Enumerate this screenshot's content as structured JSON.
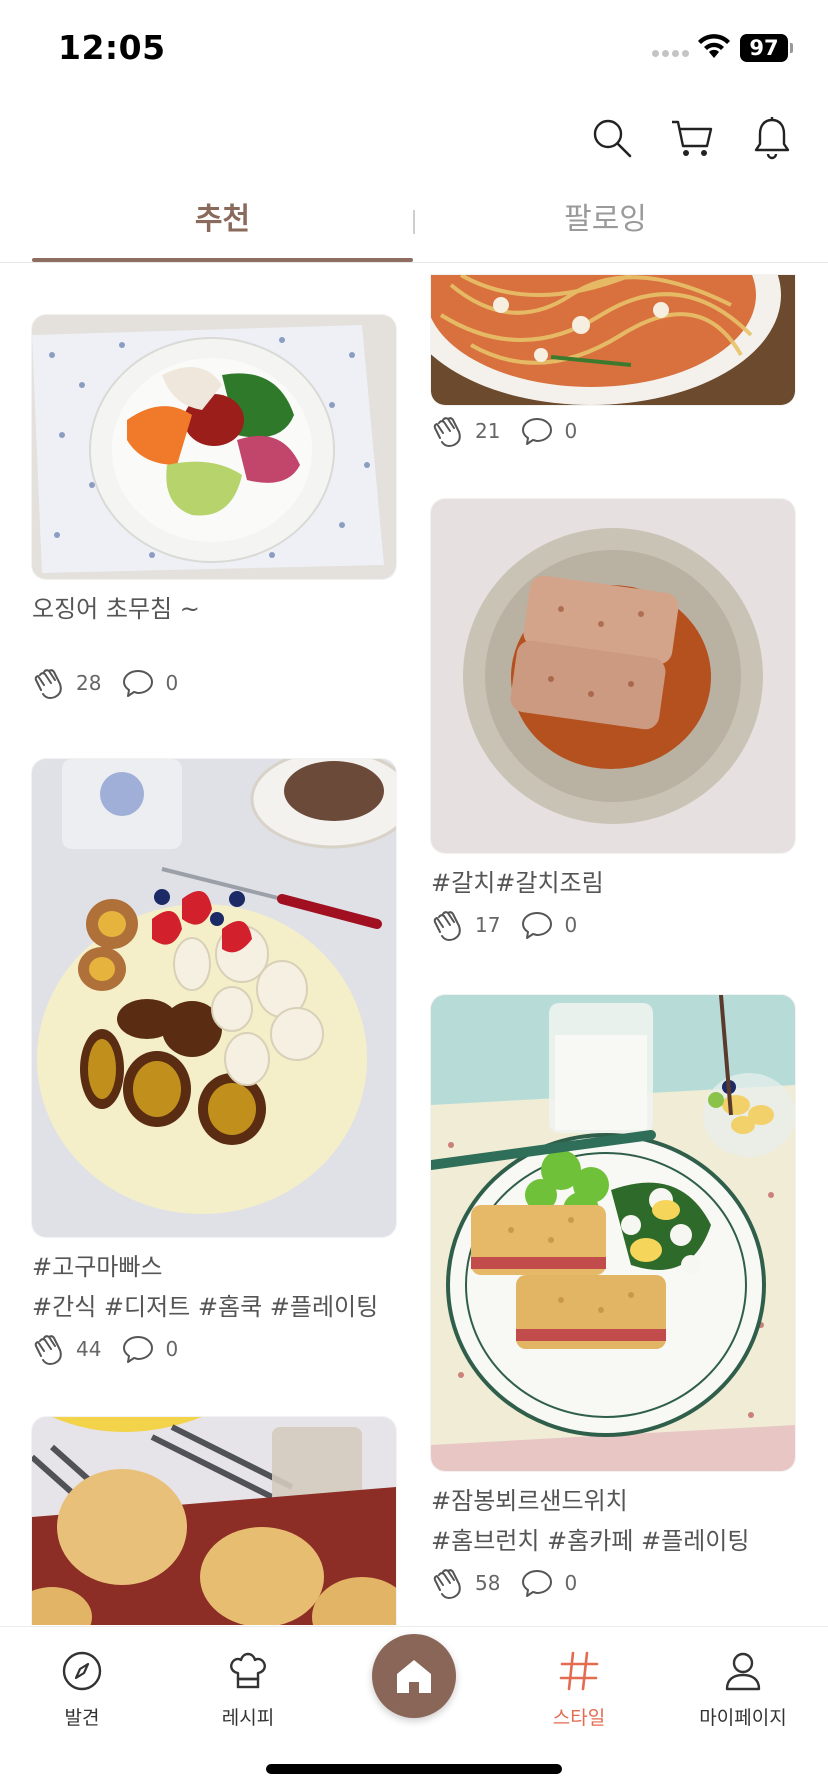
{
  "status_bar": {
    "time": "12:05",
    "battery": "97"
  },
  "tabs": {
    "recommend": "추천",
    "following": "팔로잉"
  },
  "posts": [
    {
      "caption_lines": [],
      "likes": "21",
      "comments": "0"
    },
    {
      "caption_lines": [
        "오징어 초무침 ~"
      ],
      "likes": "28",
      "comments": "0"
    },
    {
      "caption_lines": [
        "#갈치#갈치조림"
      ],
      "likes": "17",
      "comments": "0"
    },
    {
      "caption_lines": [
        "#고구마빠스",
        "#간식 #디저트 #홈쿡 #플레이팅"
      ],
      "likes": "44",
      "comments": "0"
    },
    {
      "caption_lines": [
        "#잠봉뵈르샌드위치",
        "#홈브런치 #홈카페 #플레이팅"
      ],
      "likes": "58",
      "comments": "0"
    },
    {
      "caption_lines": [],
      "likes": "",
      "comments": ""
    }
  ],
  "bottom_nav": {
    "discover": "발견",
    "recipe": "레시피",
    "style": "스타일",
    "mypage": "마이페이지"
  },
  "colors": {
    "accent_brown": "#8a6658",
    "active_tab_text": "#8a6a5a",
    "style_active": "#e36b4f"
  }
}
